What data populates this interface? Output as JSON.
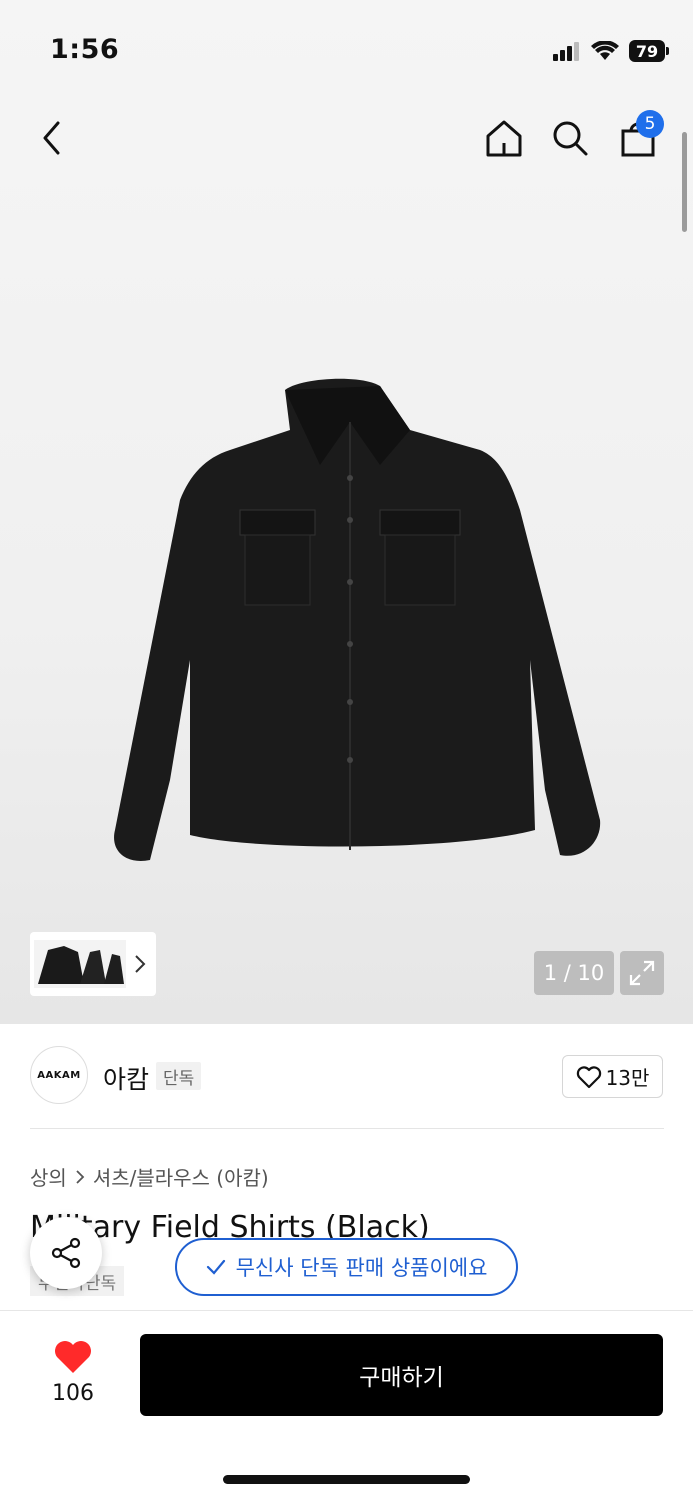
{
  "status": {
    "time": "1:56",
    "battery": "79"
  },
  "nav": {
    "back_icon": "chevron-left-icon",
    "home_icon": "home-icon",
    "search_icon": "search-icon",
    "cart_icon": "shopping-bag-icon",
    "cart_count": "5"
  },
  "gallery": {
    "counter": "1 / 10",
    "expand_icon": "expand-icon"
  },
  "brand": {
    "logo_text": "AAKAM",
    "name": "아캄",
    "tag": "단독",
    "like_count": "13만"
  },
  "product": {
    "breadcrumb": [
      "상의",
      "셔츠/블라우스 (아캄)"
    ],
    "title": "Military Field Shirts (Black)",
    "chip": "무신사단독",
    "toast": "무신사 단독 판매 상품이에요"
  },
  "bottom": {
    "heart_count": "106",
    "buy_label": "구매하기"
  },
  "colors": {
    "accent": "#1f5fd1",
    "badge": "#1f6feb",
    "heart": "#ff2a2a",
    "buy_bg": "#000000"
  }
}
